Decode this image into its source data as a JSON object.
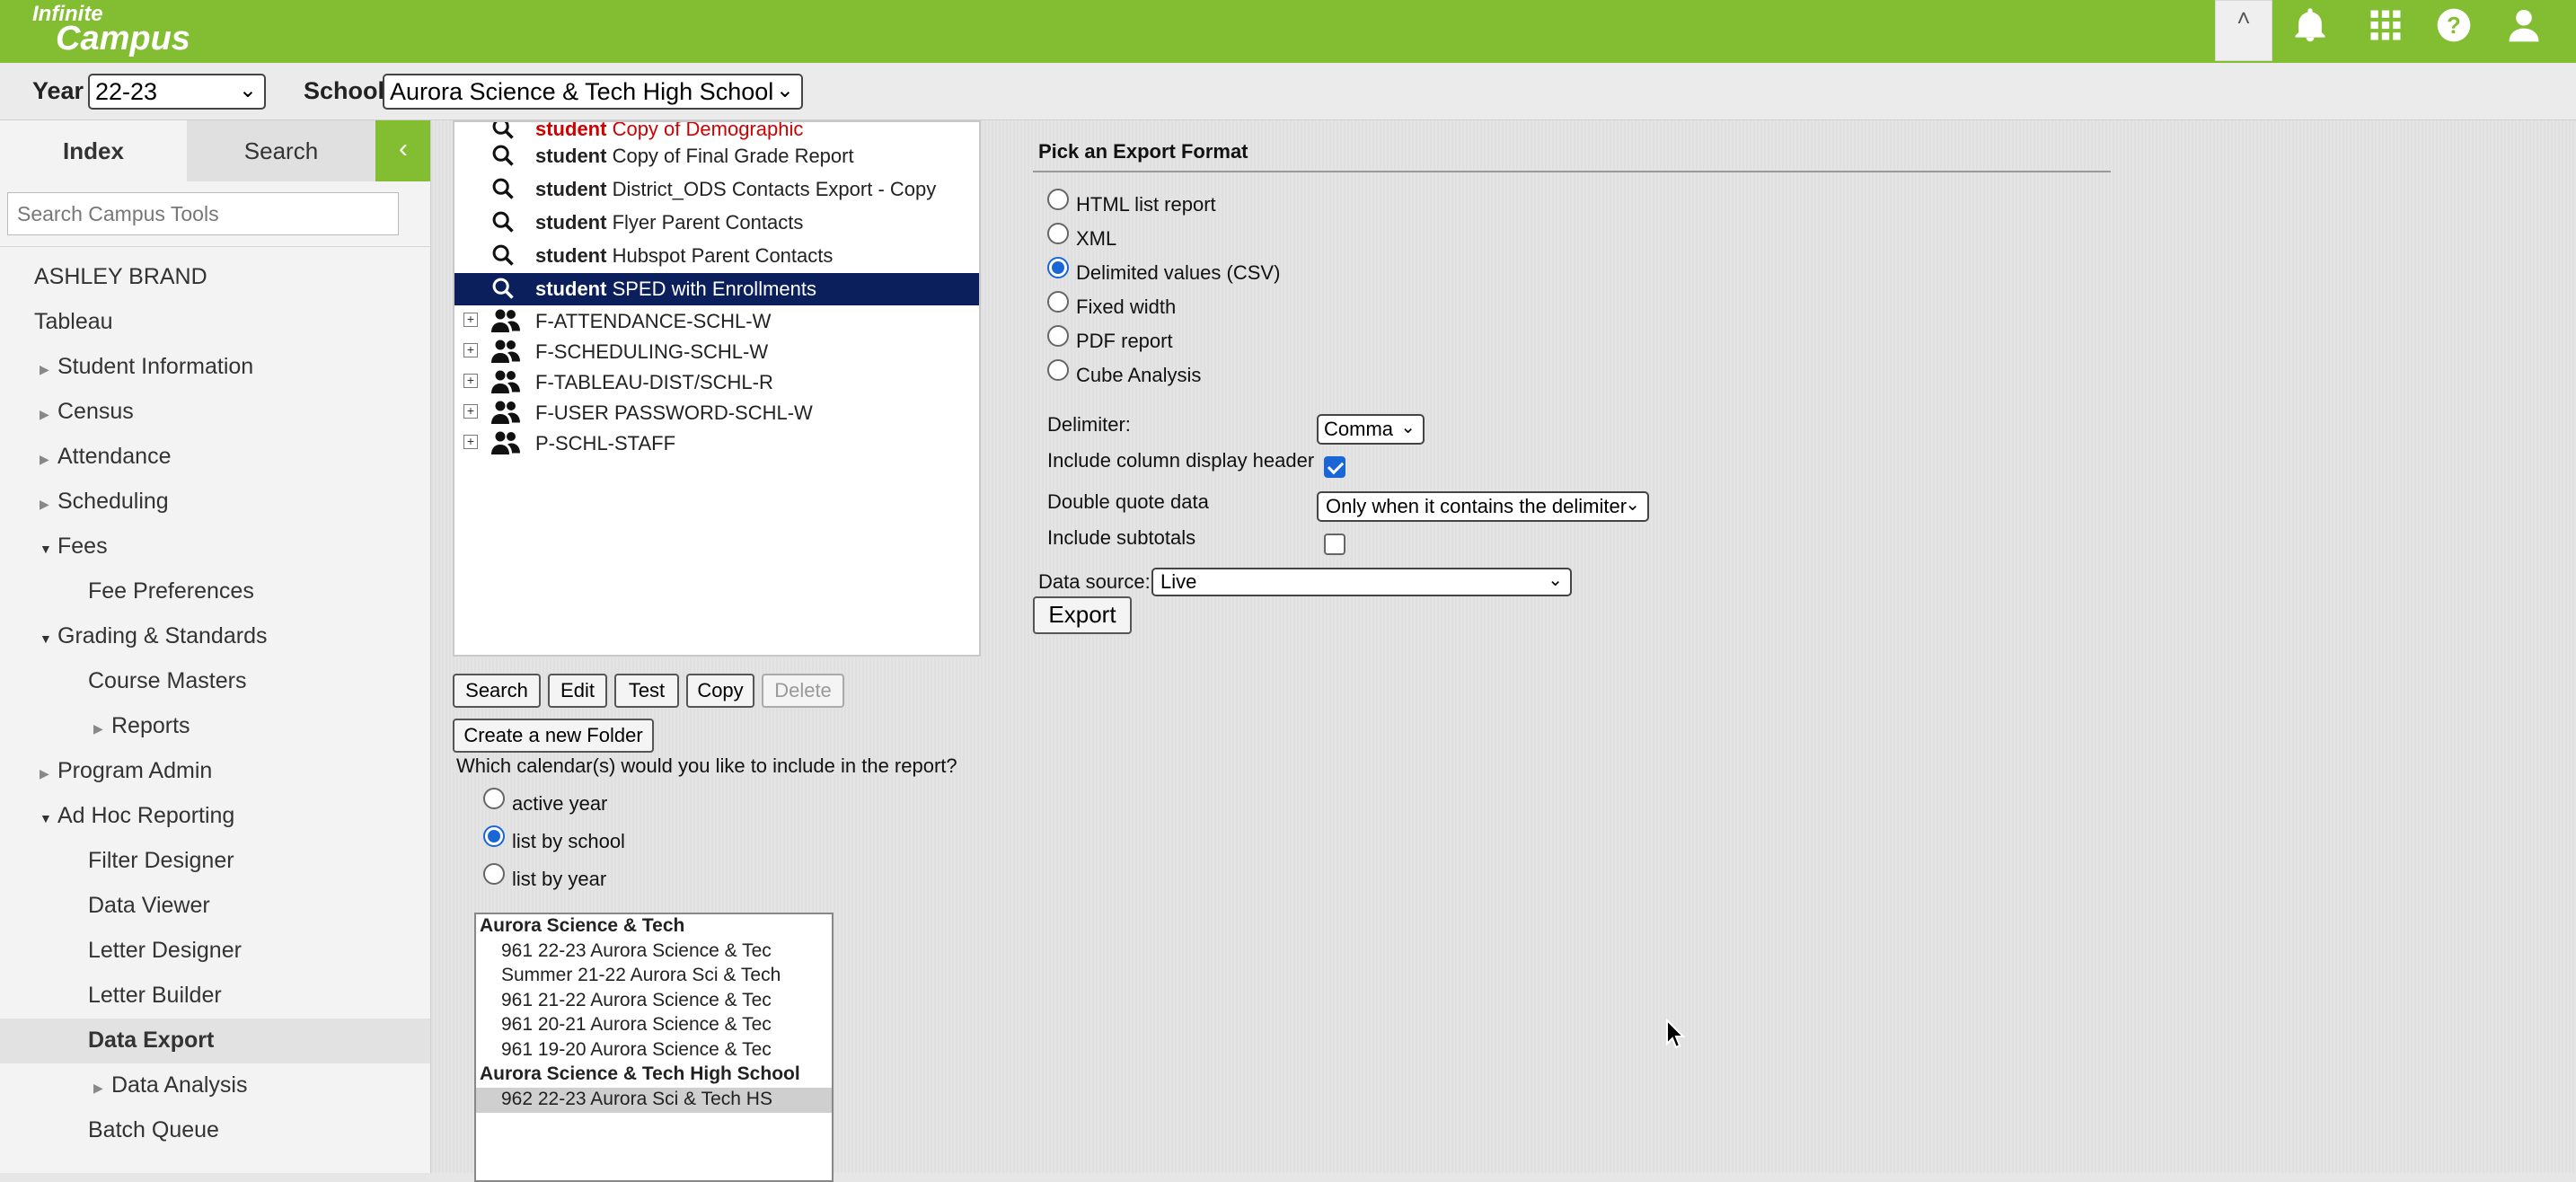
{
  "app": {
    "logo_top": "Infinite",
    "logo_bottom": "Campus"
  },
  "icons": {
    "collapse": "chevron-up-icon",
    "notifications": "bell-icon",
    "apps": "grid-icon",
    "help": "help-icon",
    "user": "user-icon"
  },
  "colors": {
    "brand_green": "#83bd31",
    "selection_navy": "#0a1f5c",
    "radio_blue": "#1a66d6"
  },
  "context": {
    "year_label": "Year",
    "year_value": "22-23",
    "school_label": "School",
    "school_value": "Aurora Science & Tech High School"
  },
  "sidebar": {
    "tab_index": "Index",
    "tab_search": "Search",
    "collapse_glyph": "‹",
    "search_placeholder": "Search Campus Tools",
    "items": [
      {
        "label": "ASHLEY BRAND"
      },
      {
        "label": "Tableau"
      },
      {
        "label": "Student Information"
      },
      {
        "label": "Census"
      },
      {
        "label": "Attendance"
      },
      {
        "label": "Scheduling"
      },
      {
        "label": "Fees"
      },
      {
        "label": "Fee Preferences"
      },
      {
        "label": "Grading & Standards"
      },
      {
        "label": "Course Masters"
      },
      {
        "label": "Reports"
      },
      {
        "label": "Program Admin"
      },
      {
        "label": "Ad Hoc Reporting"
      },
      {
        "label": "Filter Designer"
      },
      {
        "label": "Data Viewer"
      },
      {
        "label": "Letter Designer"
      },
      {
        "label": "Letter Builder"
      },
      {
        "label": "Data Export"
      },
      {
        "label": "Data Analysis"
      },
      {
        "label": "Batch Queue"
      }
    ]
  },
  "tree": {
    "rows": [
      {
        "prefix": "student",
        "label": "Copy of Demographic"
      },
      {
        "prefix": "student",
        "label": "Copy of Final Grade Report"
      },
      {
        "prefix": "student",
        "label": "District_ODS Contacts Export - Copy"
      },
      {
        "prefix": "student",
        "label": "Flyer Parent Contacts"
      },
      {
        "prefix": "student",
        "label": "Hubspot Parent Contacts"
      },
      {
        "prefix": "student",
        "label": "SPED with Enrollments"
      }
    ],
    "folders": [
      {
        "label": "F-ATTENDANCE-SCHL-W"
      },
      {
        "label": "F-SCHEDULING-SCHL-W"
      },
      {
        "label": "F-TABLEAU-DIST/SCHL-R"
      },
      {
        "label": "F-USER PASSWORD-SCHL-W"
      },
      {
        "label": "P-SCHL-STAFF"
      }
    ],
    "expand_glyph": "+"
  },
  "actions": {
    "search": "Search",
    "edit": "Edit",
    "test": "Test",
    "copy": "Copy",
    "delete": "Delete",
    "new_folder": "Create a new Folder"
  },
  "calendar": {
    "question": "Which calendar(s) would you like to include in the report?",
    "options": [
      "active year",
      "list by school",
      "list by year"
    ],
    "selected": "list by school",
    "list": [
      {
        "text": "Aurora Science & Tech"
      },
      {
        "text": "961 22-23 Aurora Science & Tec"
      },
      {
        "text": "Summer 21-22 Aurora Sci & Tech"
      },
      {
        "text": "961 21-22 Aurora Science & Tec"
      },
      {
        "text": "961 20-21 Aurora Science & Tec"
      },
      {
        "text": "961 19-20 Aurora Science & Tec"
      },
      {
        "text": "Aurora Science & Tech High School"
      },
      {
        "text": "962 22-23 Aurora Sci & Tech HS"
      }
    ]
  },
  "export": {
    "title": "Pick an Export Format",
    "formats": [
      "HTML list report",
      "XML",
      "Delimited values (CSV)",
      "Fixed width",
      "PDF report",
      "Cube Analysis"
    ],
    "selected_format": "Delimited values (CSV)",
    "delimiter_label": "Delimiter:",
    "delimiter_value": "Comma",
    "header_label": "Include column display header",
    "header_checked": true,
    "quote_label": "Double quote data",
    "quote_value": "Only when it contains the delimiter",
    "subtotals_label": "Include subtotals",
    "subtotals_checked": false,
    "source_label": "Data source:",
    "source_value": "Live",
    "export_button": "Export"
  }
}
